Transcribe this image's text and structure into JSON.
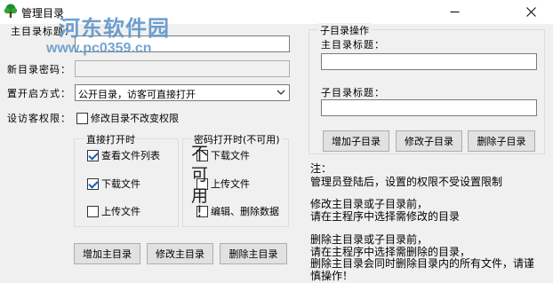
{
  "window": {
    "title": "管理目录",
    "icon": "tree-icon",
    "minimize": "minimize-icon",
    "close": "close-icon"
  },
  "watermark": {
    "name": "河东软件园",
    "url": "www.pc0359.cn"
  },
  "left": {
    "main_title_label": "主目录标题：",
    "new_password_label": "新目录密码：",
    "open_mode_label": "置开启方式：",
    "open_mode_value": "公开目录，访客可直接打开",
    "guest_perm_label": "设访客权限：",
    "no_change_perm": "修改目录不改变权限",
    "direct_group": {
      "title": "直接打开时",
      "items": [
        {
          "label": "查看文件列表",
          "checked": true
        },
        {
          "label": "下载文件",
          "checked": true
        },
        {
          "label": "上传文件",
          "checked": false
        }
      ]
    },
    "password_group": {
      "title": "密码打开时(不可用)",
      "items": [
        {
          "label": "下载文件",
          "checked": false
        },
        {
          "label": "上传文件",
          "checked": false
        },
        {
          "label": "编辑、删除数据",
          "checked": false
        }
      ]
    },
    "unavailable_overlay": [
      "不",
      "可",
      "用",
      "!"
    ],
    "buttons": {
      "add": "增加主目录",
      "edit": "修改主目录",
      "delete": "删除主目录"
    }
  },
  "right": {
    "group_title": "子目录操作",
    "main_title_label": "主目录标题：",
    "sub_title_label": "子目录标题：",
    "buttons": {
      "add": "增加子目录",
      "edit": "修改子目录",
      "delete": "删除子目录"
    }
  },
  "notes": [
    "注：",
    "管理员登陆后，设置的权限不受设置限制",
    "修改主目录或子目录前，",
    "请在主程序中选择需修改的目录",
    "删除主目录或子目录前，",
    "请在主程序中选择需删除的目录，",
    "删除主目录会同时删除目录内的所有文件，请谨",
    "慎操作！"
  ]
}
